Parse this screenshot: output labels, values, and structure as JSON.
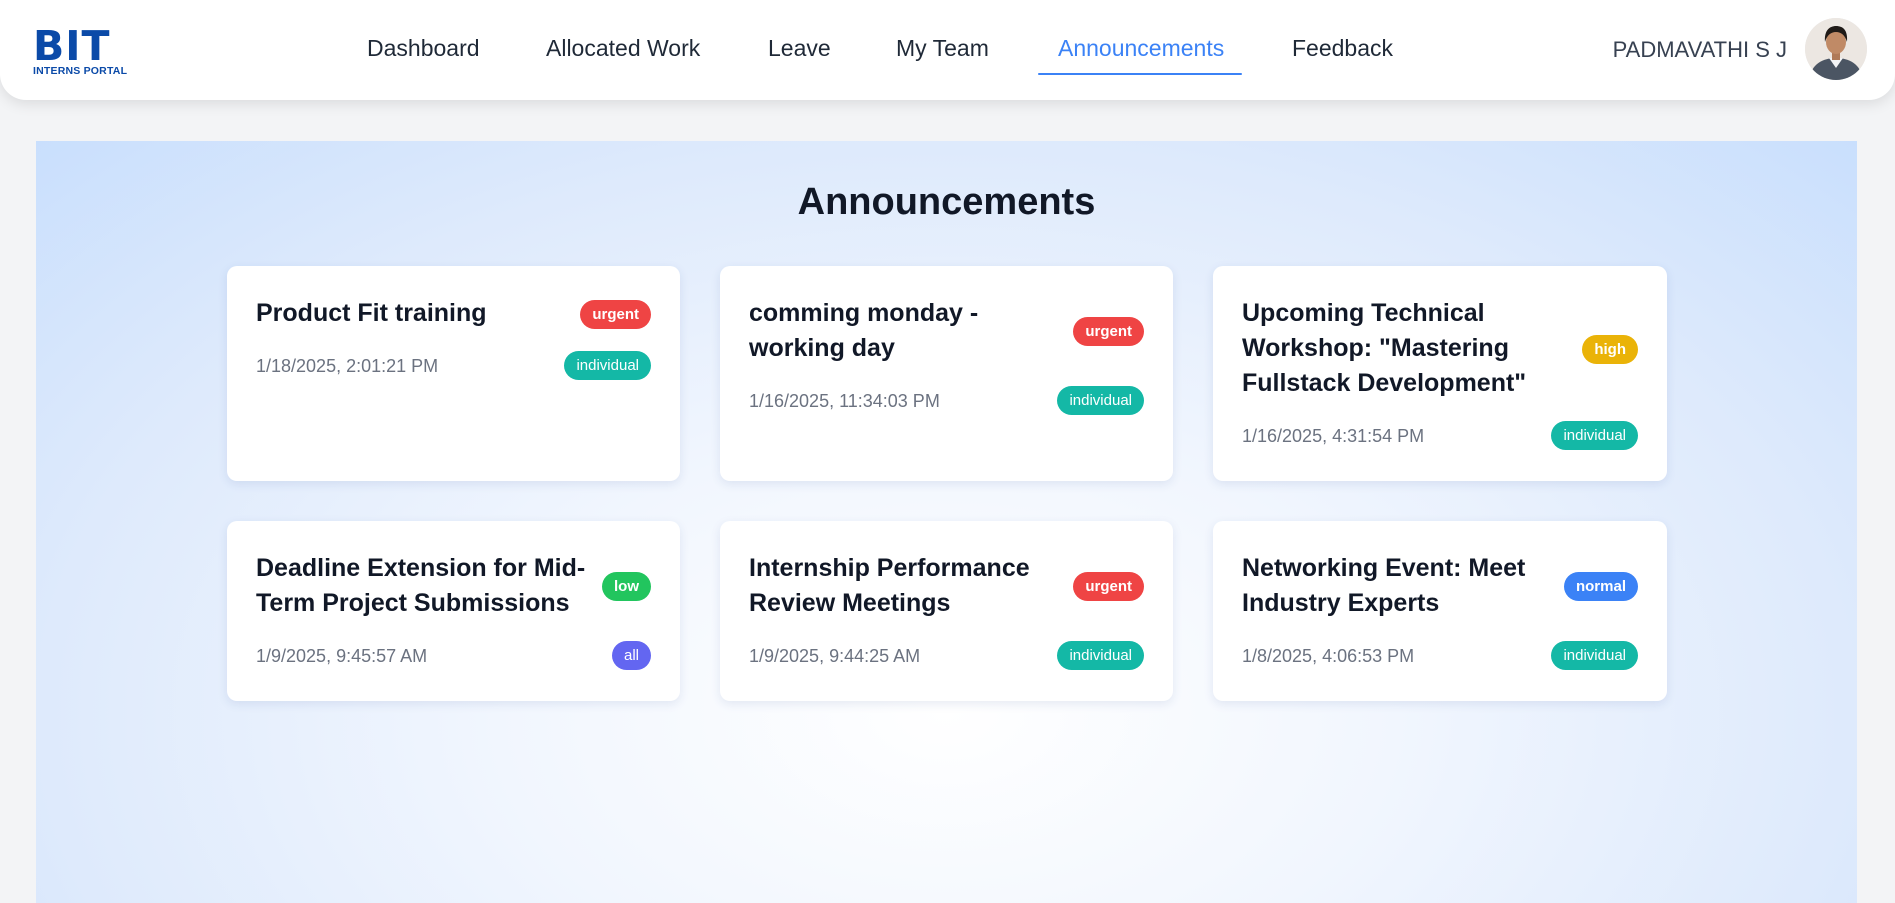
{
  "header": {
    "logo_main": "BIT",
    "logo_sub": "INTERNS PORTAL",
    "nav": [
      {
        "label": "Dashboard"
      },
      {
        "label": "Allocated Work"
      },
      {
        "label": "Leave"
      },
      {
        "label": "My Team"
      },
      {
        "label": "Announcements",
        "active": true
      },
      {
        "label": "Feedback"
      }
    ],
    "user_name": "PADMAVATHI S J"
  },
  "main": {
    "title": "Announcements",
    "announcements": [
      {
        "title": "Product Fit training",
        "date": "1/18/2025, 2:01:21 PM",
        "priority": "urgent",
        "scope": "individual"
      },
      {
        "title": "comming monday - working day",
        "date": "1/16/2025, 11:34:03 PM",
        "priority": "urgent",
        "scope": "individual"
      },
      {
        "title": "Upcoming Technical Workshop: \"Mastering Fullstack Development\"",
        "date": "1/16/2025, 4:31:54 PM",
        "priority": "high",
        "scope": "individual"
      },
      {
        "title": "Deadline Extension for Mid-Term Project Submissions",
        "date": "1/9/2025, 9:45:57 AM",
        "priority": "low",
        "scope": "all"
      },
      {
        "title": "Internship Performance Review Meetings",
        "date": "1/9/2025, 9:44:25 AM",
        "priority": "urgent",
        "scope": "individual"
      },
      {
        "title": "Networking Event: Meet Industry Experts",
        "date": "1/8/2025, 4:06:53 PM",
        "priority": "normal",
        "scope": "individual"
      }
    ]
  },
  "colors": {
    "accent": "#3b82f6",
    "urgent": "#ef4444",
    "high": "#eab308",
    "low": "#22c55e",
    "normal": "#3b82f6",
    "individual": "#14b8a6",
    "all": "#6366f1"
  }
}
